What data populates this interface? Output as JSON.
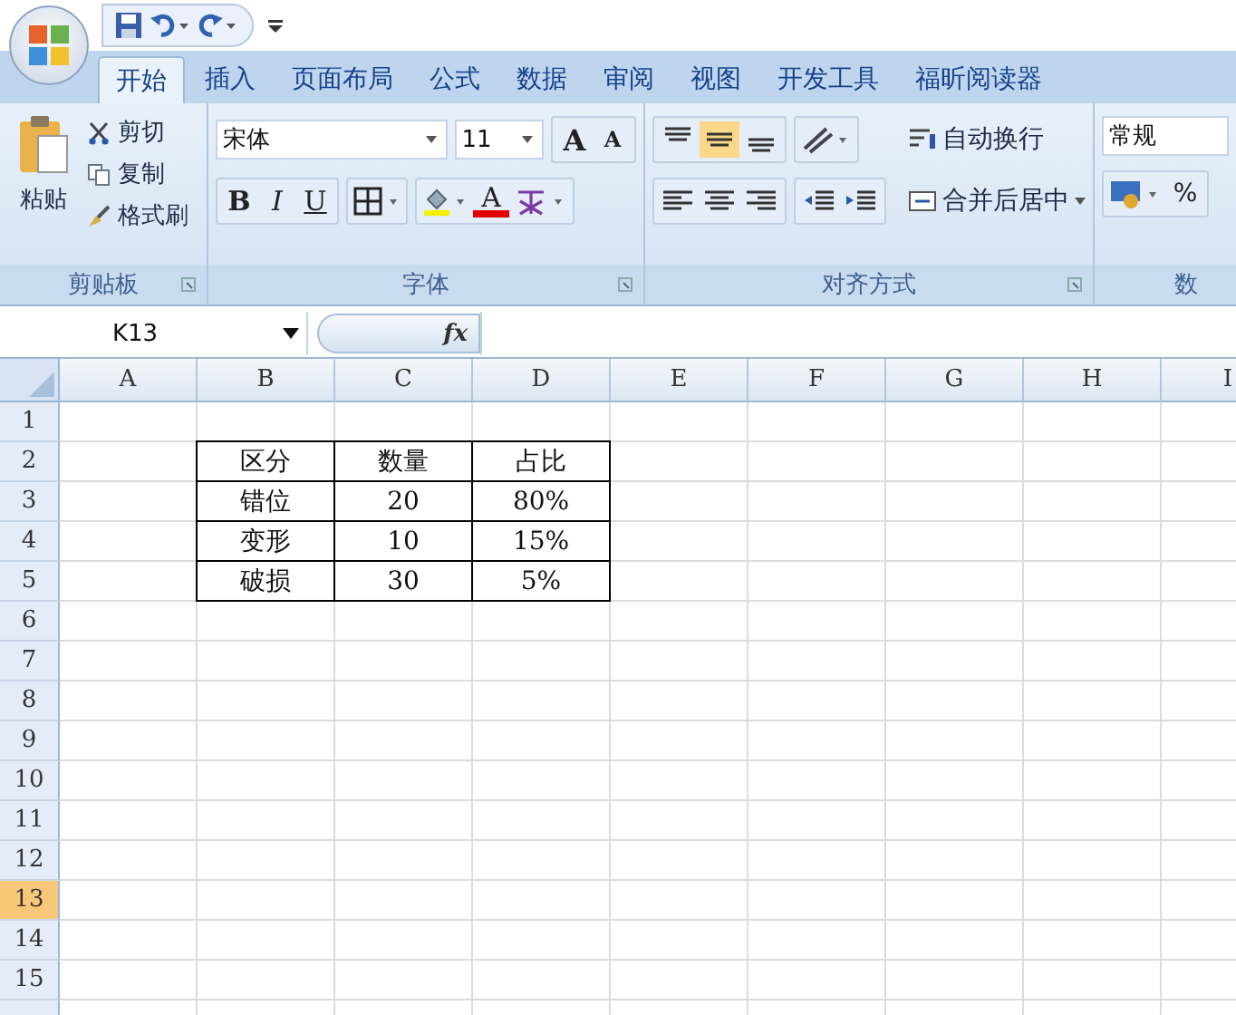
{
  "tabs": [
    {
      "label": "开始",
      "selected": true
    },
    {
      "label": "插入",
      "selected": false
    },
    {
      "label": "页面布局",
      "selected": false
    },
    {
      "label": "公式",
      "selected": false
    },
    {
      "label": "数据",
      "selected": false
    },
    {
      "label": "审阅",
      "selected": false
    },
    {
      "label": "视图",
      "selected": false
    },
    {
      "label": "开发工具",
      "selected": false
    },
    {
      "label": "福昕阅读器",
      "selected": false
    }
  ],
  "clipboard": {
    "paste": "粘贴",
    "cut": "剪切",
    "copy": "复制",
    "format_painter": "格式刷",
    "label": "剪贴板"
  },
  "font": {
    "name": "宋体",
    "size": "11",
    "grow": "A",
    "shrink": "A",
    "bold": "B",
    "italic": "I",
    "underline": "U",
    "font_color": "A",
    "label": "字体"
  },
  "alignment": {
    "vertical": [
      {
        "kind": "top",
        "selected": false
      },
      {
        "kind": "middle",
        "selected": true
      },
      {
        "kind": "bottom",
        "selected": false
      }
    ],
    "wrap": "自动换行",
    "merge": "合并后居中",
    "label": "对齐方式"
  },
  "number": {
    "format": "常规",
    "percent": "%",
    "label": "数"
  },
  "formula_bar": {
    "name_box": "K13",
    "fx": "fx"
  },
  "columns": [
    "A",
    "B",
    "C",
    "D",
    "E",
    "F",
    "G",
    "H",
    "I"
  ],
  "rows": [
    {
      "label": "1",
      "selected": false
    },
    {
      "label": "2",
      "selected": false
    },
    {
      "label": "3",
      "selected": false
    },
    {
      "label": "4",
      "selected": false
    },
    {
      "label": "5",
      "selected": false
    },
    {
      "label": "6",
      "selected": false
    },
    {
      "label": "7",
      "selected": false
    },
    {
      "label": "8",
      "selected": false
    },
    {
      "label": "9",
      "selected": false
    },
    {
      "label": "10",
      "selected": false
    },
    {
      "label": "11",
      "selected": false
    },
    {
      "label": "12",
      "selected": false
    },
    {
      "label": "13",
      "selected": true
    },
    {
      "label": "14",
      "selected": false
    },
    {
      "label": "15",
      "selected": false
    }
  ],
  "table": [
    [
      "区分",
      "数量",
      "占比"
    ],
    [
      "错位",
      "20",
      "80%"
    ],
    [
      "变形",
      "10",
      "15%"
    ],
    [
      "破损",
      "30",
      "5%"
    ]
  ]
}
